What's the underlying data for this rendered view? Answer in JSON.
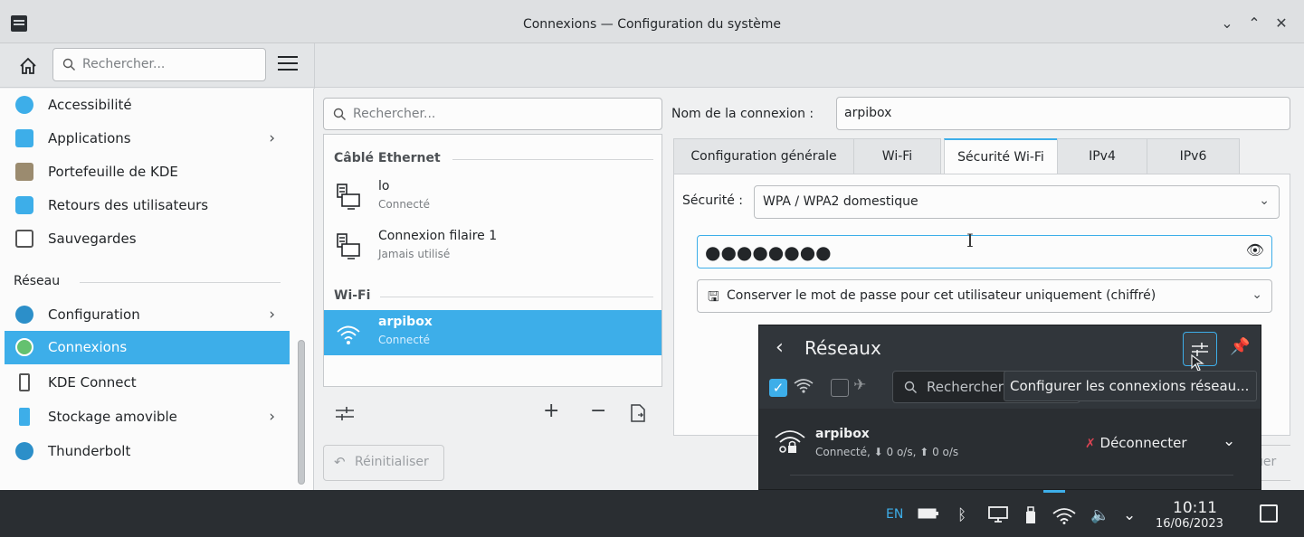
{
  "window": {
    "title": "Connexions — Configuration du système",
    "controls": [
      "⌄",
      "⌃",
      "✕"
    ]
  },
  "sidebar": {
    "search_placeholder": "Rechercher...",
    "items": [
      {
        "label": "Accessibilité"
      },
      {
        "label": "Applications"
      },
      {
        "label": "Portefeuille de KDE"
      },
      {
        "label": "Retours des utilisateurs"
      },
      {
        "label": "Sauvegardes"
      },
      {
        "label": "Configuration"
      },
      {
        "label": "Connexions"
      },
      {
        "label": "KDE Connect"
      },
      {
        "label": "Stockage amovible"
      },
      {
        "label": "Thunderbolt"
      }
    ],
    "section_network": "Réseau"
  },
  "connections": {
    "search_placeholder": "Rechercher...",
    "groups": [
      {
        "header": "Câblé Ethernet"
      },
      {
        "header": "Wi-Fi"
      }
    ],
    "items": [
      {
        "name": "lo",
        "status": "Connecté"
      },
      {
        "name": "Connexion filaire 1",
        "status": "Jamais utilisé"
      },
      {
        "name": "arpibox",
        "status": "Connecté"
      }
    ],
    "reset_label": "Réinitialiser"
  },
  "details": {
    "name_label": "Nom de la connexion :",
    "name_value": "arpibox",
    "tabs": [
      {
        "label": "Configuration générale"
      },
      {
        "label": "Wi-Fi"
      },
      {
        "label": "Sécurité Wi-Fi"
      },
      {
        "label": "IPv4"
      },
      {
        "label": "IPv6"
      }
    ],
    "active_tab": "Sécurité Wi-Fi",
    "security_label": "Sécurité :",
    "security_value": "WPA / WPA2 domestique",
    "password_masked": "●●●●●●●●",
    "store_option": "Conserver le mot de passe pour cet utilisateur uniquement (chiffré)",
    "apply_fragment": "uer"
  },
  "popup": {
    "title": "Réseaux",
    "search_placeholder": "Rechercher",
    "tooltip": "Configurer les connexions réseau...",
    "network": {
      "name": "arpibox",
      "status": "Connecté, ⬇ 0 o/s, ⬆ 0 o/s",
      "action": "Déconnecter"
    }
  },
  "taskbar": {
    "lang": "EN",
    "time": "10:11",
    "date": "16/06/2023"
  },
  "colors": {
    "accent": "#3daee9",
    "panel_dark": "#2a2e32"
  }
}
